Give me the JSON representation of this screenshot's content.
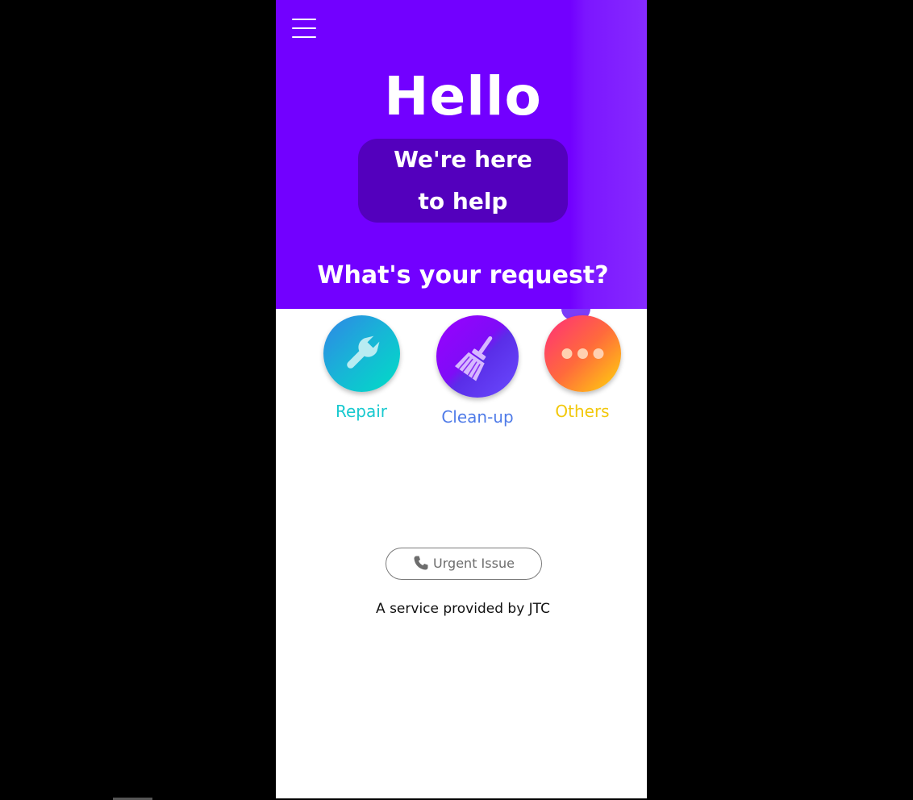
{
  "header": {
    "greeting": "Hello",
    "tagline": "We're here to help",
    "question": "What's your request?"
  },
  "services": [
    {
      "label": "Repair",
      "icon": "wrench-icon",
      "color": "#18c9cf"
    },
    {
      "label": "Clean-up",
      "icon": "broom-icon",
      "color": "#4f7be8"
    },
    {
      "label": "Others",
      "icon": "more-dots-icon",
      "color": "#f2c80c"
    }
  ],
  "urgent": {
    "label": "Urgent Issue",
    "icon": "phone-icon"
  },
  "footer": {
    "note": "A service provided by JTC"
  },
  "colors": {
    "header_bg": "#7200ff",
    "pill_bg": "#5300bd"
  }
}
